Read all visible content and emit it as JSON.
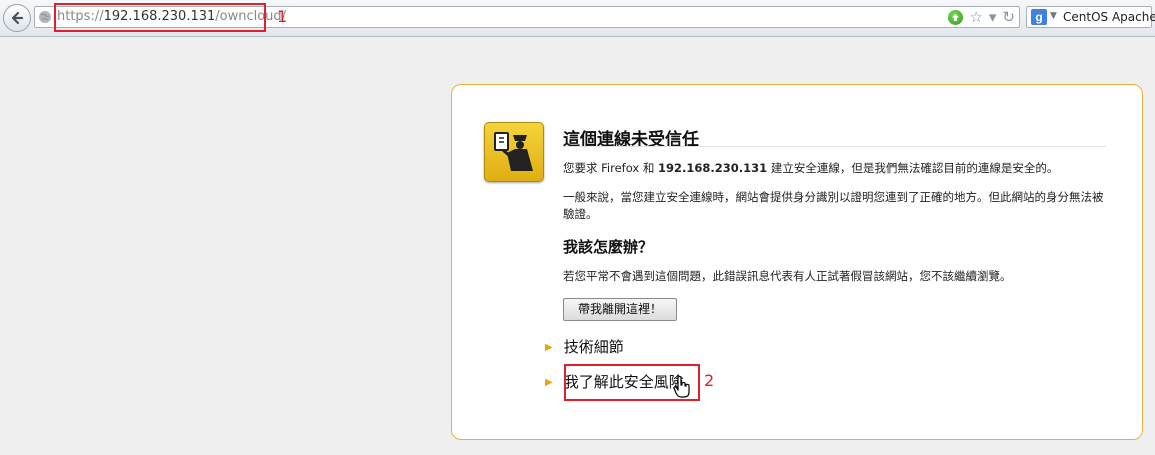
{
  "url": {
    "scheme": "https://",
    "host": "192.168.230.131",
    "path": "/owncloud/"
  },
  "search": {
    "engine": "CentOS Apache"
  },
  "annotations": {
    "first": "1",
    "second": "2"
  },
  "error": {
    "title": "這個連線未受信任",
    "p1_prefix": "您要求 Firefox 和 ",
    "p1_host": "192.168.230.131",
    "p1_suffix": " 建立安全連線，但是我們無法確認目前的連線是安全的。",
    "p2": "一般來說，當您建立安全連線時，網站會提供身分識別以證明您連到了正確的地方。但此網站的身分無法被驗證。",
    "heading2": "我該怎麼辦？",
    "p3": "若您平常不會遇到這個問題，此錯誤訊息代表有人正試著假冒該網站，您不該繼續瀏覽。",
    "leave_button": "帶我離開這裡！",
    "tech_details": "技術細節",
    "understand_risks": "我了解此安全風險"
  },
  "icons": {
    "back": "back-arrow-icon",
    "globe": "globe-icon",
    "go": "go-arrow-icon",
    "bookmark": "star-icon",
    "history": "dropdown-icon",
    "reload": "reload-icon",
    "search_engine": "google-icon",
    "officer": "security-officer-icon",
    "cursor": "hand-cursor-icon"
  },
  "colors": {
    "annotation": "#e0202a",
    "panel_border": "#e9b33b",
    "triangle": "#e8a80c"
  }
}
